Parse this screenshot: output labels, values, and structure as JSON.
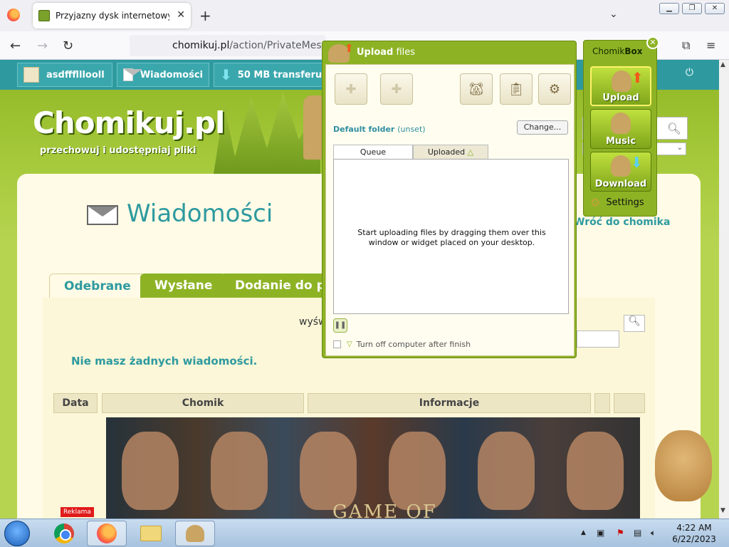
{
  "browser": {
    "tab_title": "Przyjazny dysk internetowy - Ch",
    "url_host": "chomikuj.pl",
    "url_path": "/action/PrivateMessage",
    "new_tab_symbol": "+",
    "tab_close_symbol": "✕"
  },
  "topbar": {
    "username": "asdffflllooll",
    "messages_label": "Wiadomości",
    "transfer_label": "50 MB transferu"
  },
  "site": {
    "logo": "Chomikuj.pl",
    "tagline": "przechowuj i udostępniaj pliki"
  },
  "page": {
    "heading": "Wiadomości",
    "back_link": "Wróć do chomika",
    "tabs": [
      "Odebrane",
      "Wysłane",
      "Dodanie do pol"
    ],
    "search_prefix": "wyśw",
    "empty_message": "Nie masz żadnych wiadomości.",
    "columns": [
      "Data",
      "Chomik",
      "Informacje"
    ],
    "ad_text": "GAME OF",
    "ad_badge": "Reklama"
  },
  "upload": {
    "title_bold": "Upload",
    "title_rest": "files",
    "default_folder_label": "Default folder",
    "default_folder_value": "(unset)",
    "change_button": "Change...",
    "tabs": [
      "Queue",
      "Uploaded"
    ],
    "drop_hint": "Start uploading files by dragging them over this window or widget placed on your desktop.",
    "turn_off_label": "Turn off computer after finish"
  },
  "chomikbox": {
    "title_prefix": "Chomik",
    "title_bold": "Box",
    "buttons": [
      "Upload",
      "Music",
      "Download"
    ],
    "settings": "Settings",
    "close_symbol": "✕"
  },
  "taskbar": {
    "time": "4:22 AM",
    "date": "6/22/2023"
  },
  "colors": {
    "accent_teal": "#2e9aa0",
    "site_green": "#8db325"
  }
}
